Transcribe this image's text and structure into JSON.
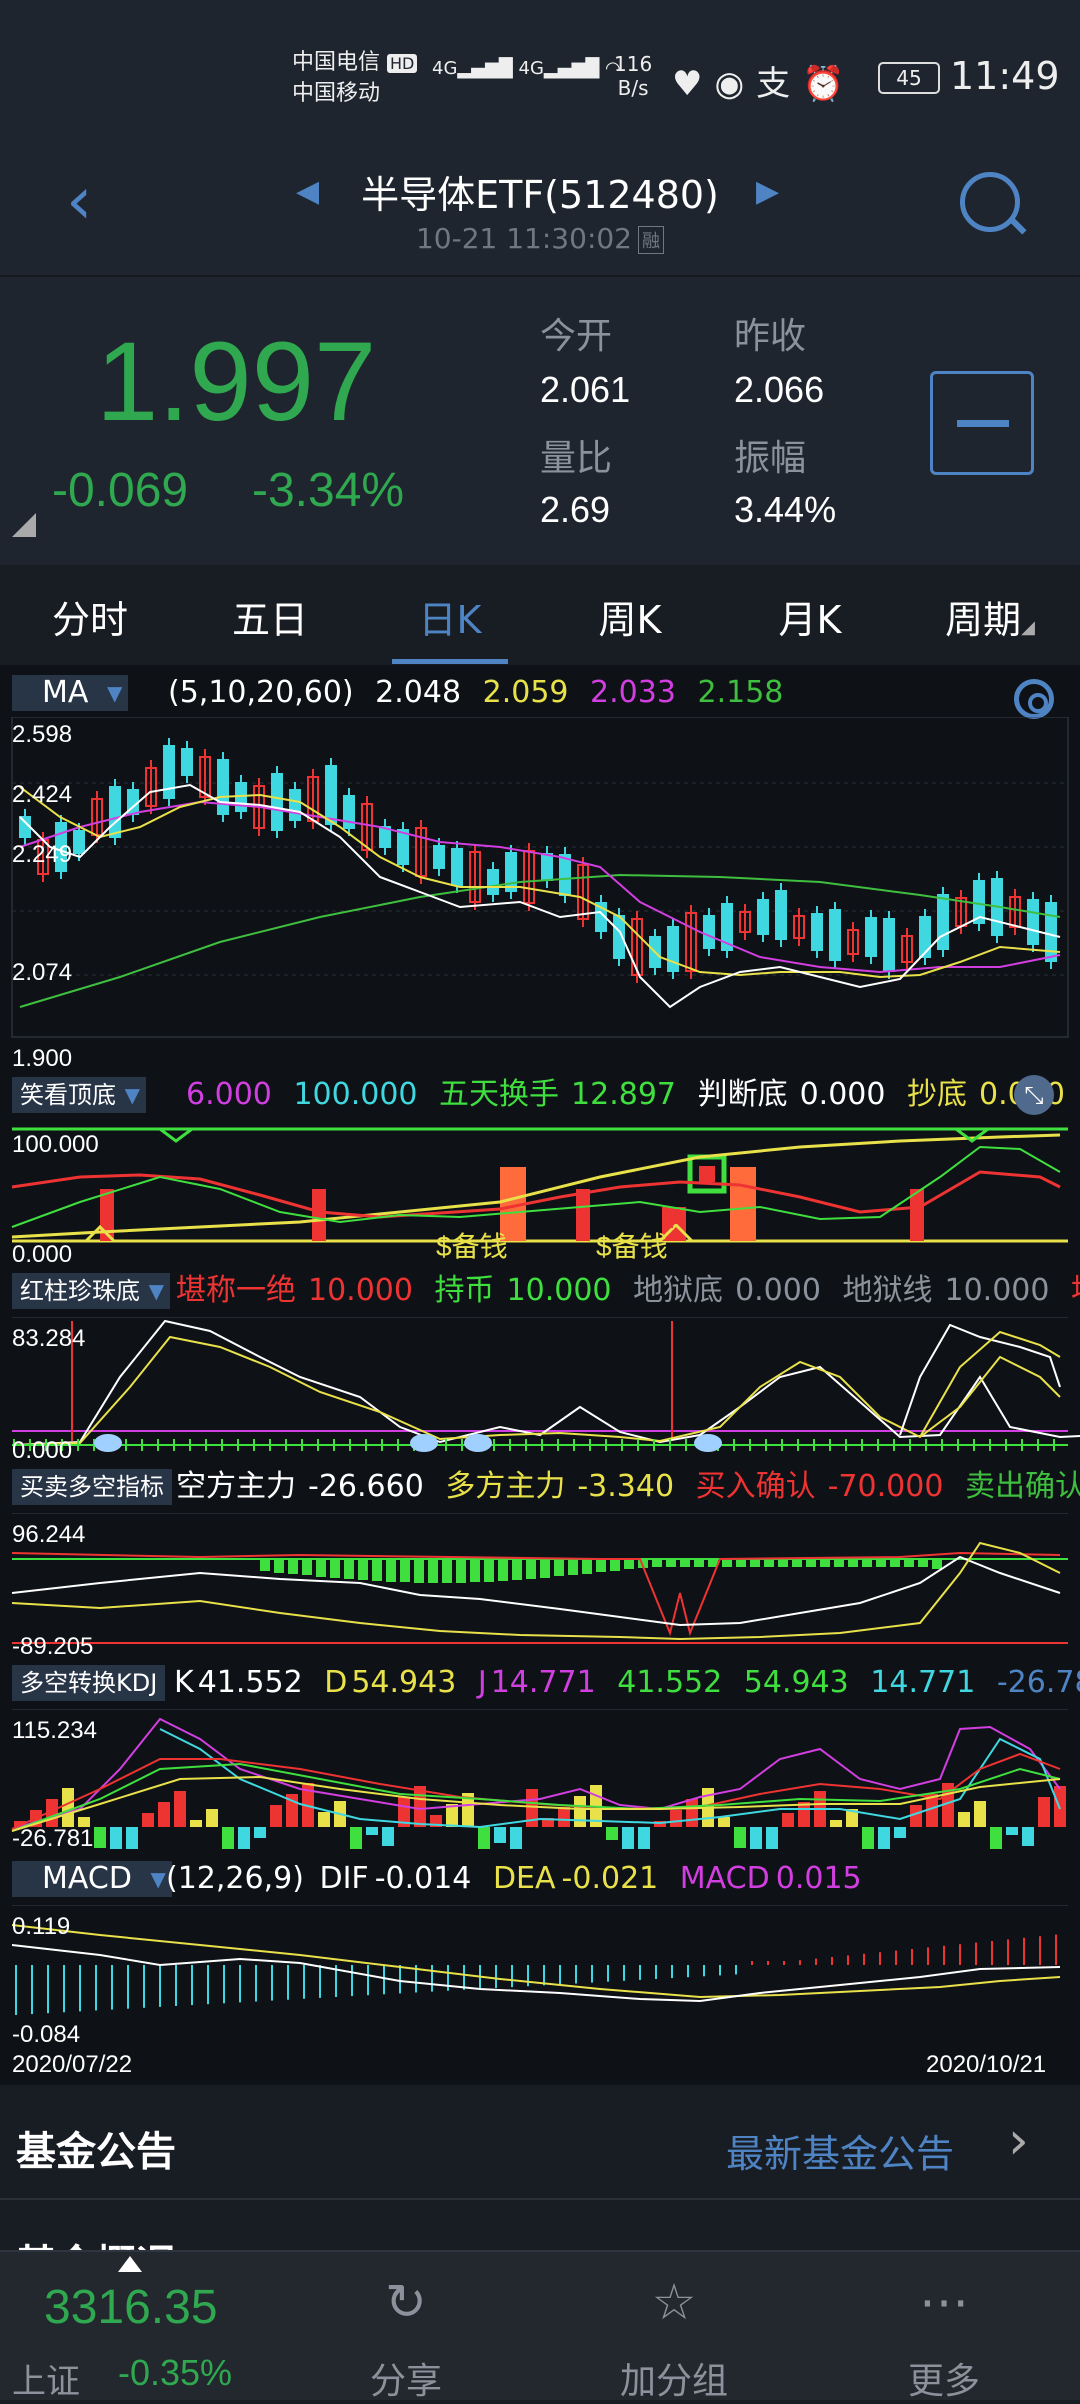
{
  "status_bar": {
    "carrier1": "中国电信",
    "carrier2": "中国移动",
    "hd": "HD",
    "net1": "4G",
    "net2": "4G",
    "speed_value": "116",
    "speed_unit": "B/s",
    "battery": "45",
    "time": "11:49"
  },
  "header": {
    "title": "半导体ETF(512480)",
    "timestamp": "10-21 11:30:02",
    "margin_badge": "融"
  },
  "quote": {
    "price": "1.997",
    "change": "-0.069",
    "change_pct": "-3.34%",
    "open_label": "今开",
    "open": "2.061",
    "prev_close_label": "昨收",
    "prev_close": "2.066",
    "vol_ratio_label": "量比",
    "vol_ratio": "2.69",
    "amplitude_label": "振幅",
    "amplitude": "3.44%",
    "price_color": "#2fa84f"
  },
  "tabs": [
    "分时",
    "五日",
    "日K",
    "周K",
    "月K",
    "周期"
  ],
  "active_tab": "日K",
  "chart": {
    "ma": {
      "badge": "MA",
      "params": "(5,10,20,60)",
      "v5": "2.048",
      "v10": "2.059",
      "v20": "2.033",
      "v60": "2.158",
      "colors": {
        "v5": "#ffffff",
        "v10": "#e8e14a",
        "v20": "#d23fe0",
        "v60": "#3fbf3f"
      },
      "y_labels": [
        "2.598",
        "2.424",
        "2.249",
        "2.074",
        "1.900"
      ]
    },
    "ind1": {
      "badge": "笑看顶底",
      "a": "6.000",
      "b": "100.000",
      "c_label": "五天换手",
      "c": "12.897",
      "d_label": "判断底",
      "d": "0.000",
      "e_label": "抄底",
      "e": "0.000",
      "y_top": "100.000",
      "y_bottom": "0.000",
      "marker1": "$备钱",
      "marker2": "$备钱",
      "marker3": "¥"
    },
    "ind2": {
      "badge": "红柱珍珠底",
      "a_label": "堪称一绝",
      "a": "10.000",
      "b_label": "持币",
      "b": "10.000",
      "c_label": "地狱底",
      "c": "0.000",
      "d_label": "地狱线",
      "d": "10.000",
      "e_label": "地",
      "y_top": "83.284",
      "y_bottom": "0.000"
    },
    "ind3": {
      "badge": "买卖多空指标",
      "a_label": "空方主力",
      "a": "-26.660",
      "b_label": "多方主力",
      "b": "-3.340",
      "c_label": "买入确认",
      "c": "-70.000",
      "d_label": "卖出确认",
      "y_top": "96.244",
      "y_bottom": "-89.205"
    },
    "ind4": {
      "badge": "多空转换KDJ",
      "k_label": "K",
      "k": "41.552",
      "d_label": "D",
      "d": "54.943",
      "j_label": "J",
      "j": "14.771",
      "v1": "41.552",
      "v2": "54.943",
      "v3": "14.771",
      "v4": "-26.78",
      "y_top": "115.234",
      "y_bottom": "-26.781"
    },
    "macd": {
      "badge": "MACD",
      "params": "(12,26,9)",
      "dif_label": "DIF",
      "dif": "-0.014",
      "dea_label": "DEA",
      "dea": "-0.021",
      "macd_label": "MACD",
      "macd": "0.015",
      "y_top": "0.119",
      "y_bottom": "-0.084"
    },
    "date_start": "2020/07/22",
    "date_end": "2020/10/21"
  },
  "notice": {
    "title": "基金公告",
    "link": "最新基金公告"
  },
  "peek": {
    "title": "基金概况"
  },
  "bottom": {
    "index_value": "3316.35",
    "index_name": "上证",
    "index_pct": "-0.35%",
    "share": "分享",
    "add_group": "加分组",
    "more": "更多"
  }
}
